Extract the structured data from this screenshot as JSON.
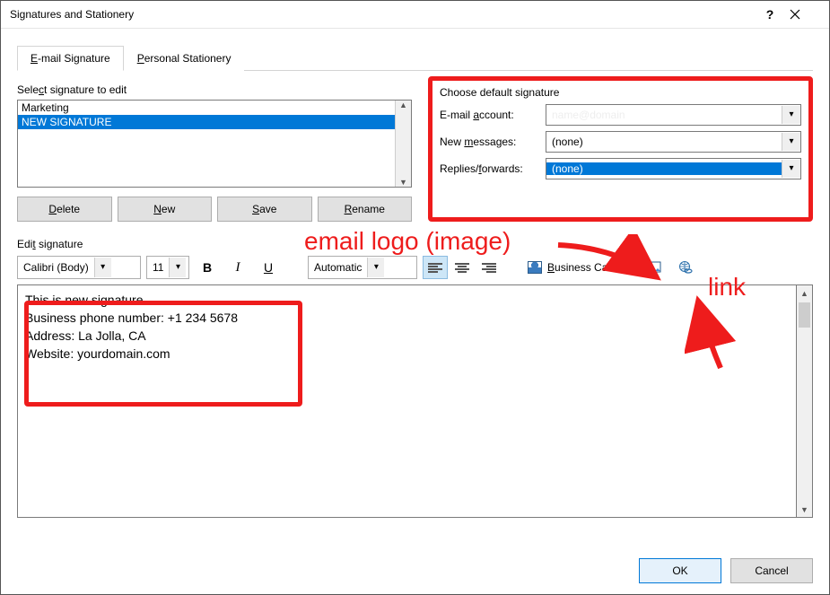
{
  "window": {
    "title": "Signatures and Stationery"
  },
  "tabs": {
    "t1": "E-mail Signature",
    "t2": "Personal Stationery"
  },
  "list": {
    "label": "Select signature to edit",
    "items": [
      "Marketing",
      "NEW SIGNATURE"
    ],
    "selected": 1
  },
  "buttons": {
    "delete": "Delete",
    "new": "New",
    "save": "Save",
    "rename": "Rename"
  },
  "defaults": {
    "heading": "Choose default signature",
    "account_label": "E-mail account:",
    "account_value": "name@domain",
    "new_label": "New messages:",
    "new_value": "(none)",
    "reply_label": "Replies/forwards:",
    "reply_value": "(none)"
  },
  "editor": {
    "label": "Edit signature",
    "font": "Calibri (Body)",
    "size": "11",
    "color": "Automatic",
    "bc": "Business Card",
    "lines": [
      "This is new signature.",
      "Business phone number: +1 234 5678",
      "Address: La Jolla, CA",
      "Website: yourdomain.com"
    ]
  },
  "annotations": {
    "logo": "email logo (image)",
    "link": "link"
  },
  "footer": {
    "ok": "OK",
    "cancel": "Cancel"
  }
}
